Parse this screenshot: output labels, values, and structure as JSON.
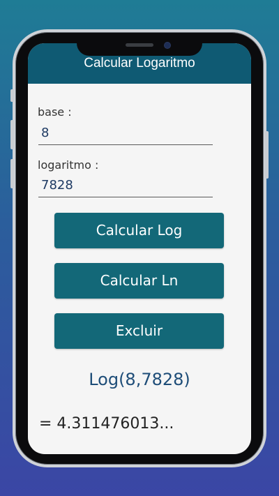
{
  "app": {
    "title": "Calcular Logaritmo",
    "accent_color": "#0f5a73",
    "button_color": "#136878"
  },
  "form": {
    "base_label": "base :",
    "base_value": "8",
    "log_label": "logaritmo :",
    "log_value": "7828"
  },
  "buttons": {
    "calc_log": "Calcular Log",
    "calc_ln": "Calcular Ln",
    "clear": "Excluir"
  },
  "output": {
    "expression": "Log(8,7828)",
    "result": "= 4.311476013..."
  }
}
